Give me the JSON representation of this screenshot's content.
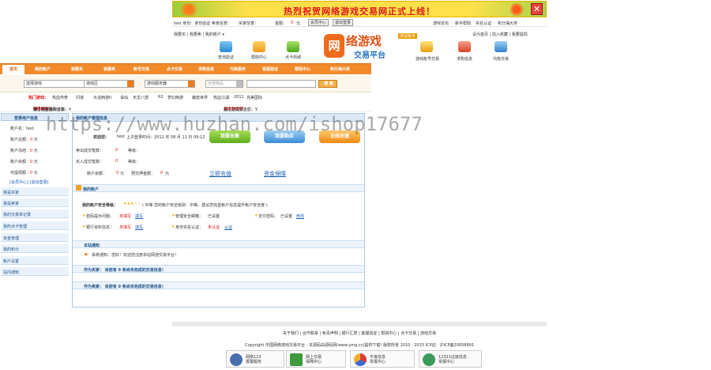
{
  "banner": {
    "text": "热烈祝贺网络游戏交易网正式上线！",
    "close": "✕"
  },
  "topbar": {
    "user": "test 身份：身份验证 卖家信誉：",
    "buyer": "买家信誉：",
    "balance": "金额：",
    "balance_value": "0",
    "unit": "元",
    "member_btn": "会员中心",
    "logout_btn": "退出登录",
    "links": [
      "游戏论坛",
      "新手帮助",
      "实名认证",
      "积分抽大奖"
    ]
  },
  "header": {
    "left_links": "我要买 | 我要卖 | 我的账户 ▾",
    "right_links": "设为首页 | 加入收藏 | 我要提现",
    "icons_left": [
      "查询验证",
      "帮助中心",
      "点卡商城"
    ],
    "logo_mark": "网",
    "logo_t1": "络游戏",
    "logo_t2": "交易平台",
    "logo_badge": "测试版本",
    "icons_right": [
      "游戏账号交易",
      "求购信息",
      "代练交易"
    ]
  },
  "nav": {
    "home": "首页",
    "items": [
      "我的帐户",
      "我要买",
      "我要卖",
      "帐号交易",
      "点卡交易",
      "求购信息",
      "代练服务",
      "客服验证",
      "帮助中心",
      "积分抽大奖"
    ]
  },
  "search": {
    "game": "选择游戏",
    "area": "游戏区",
    "server": "游戏服务器",
    "type": "全部物品",
    "keyword": "",
    "button": "搜 索"
  },
  "hot": {
    "label": "热门游戏：",
    "items": [
      "热血传奇",
      "问道",
      "大话西游II",
      "诛仙",
      "天龙八部",
      "R2",
      "梦幻西游",
      "魔兽世界",
      "热血江湖",
      "2011",
      "完美国际"
    ]
  },
  "stats": {
    "a_pre": "会员注册数：",
    "a_val": "643471",
    "a_mid": "个 | 玩家求购金额：¥",
    "a_amt": "4691235",
    "a_mid2": "元 | 寄售担保订单：",
    "a_cnt": "61763",
    "a_end": "单",
    "b_pre": "总成交次数：",
    "b_val": "385345",
    "b_mid": "单 | 总成交金额：¥",
    "b_amt": "16654387",
    "b_end": "元"
  },
  "sidebar": {
    "title": "登录用户信息",
    "user_label": "账户名：",
    "user_value": "test",
    "rows": [
      {
        "label": "账户总额：",
        "value": "0",
        "unit": "元"
      },
      {
        "label": "账户冻结：",
        "value": "0",
        "unit": "元"
      },
      {
        "label": "账户余额：",
        "value": "0",
        "unit": "元"
      },
      {
        "label": "可提现额：",
        "value": "0",
        "unit": "元"
      }
    ],
    "links": "[会员中心]    [退出登录]",
    "menu": [
      "我是买家",
      "我是卖家",
      "我的交易单记录",
      "我的点卡管理",
      "资金管理",
      "我的积分",
      "帐户设置",
      "站内通知"
    ]
  },
  "main": {
    "title": "我的帐户管理信息",
    "welcome": "欢迎您：",
    "username": "test",
    "last_login": "上次登录时间：2012 年 08 月 11 日 09:12",
    "btn_sell": "我要出售",
    "btn_buy": "我要购买",
    "btn_charge": "在线充值",
    "sold_label": "卖出成交笔数：",
    "sold_value": "0",
    "level_label": "等级：",
    "bought_label": "买入成交笔数：",
    "bought_value": "0",
    "account_label": "账户余额：",
    "account_value": "0",
    "account_unit": "元",
    "prepaid_label": "预交押金额：",
    "prepaid_value": "0",
    "prepaid_unit": "元",
    "link_recharge": "立即充值",
    "link_security": "资金保障",
    "section_account": "我的帐户",
    "safety_label": "我的帐户安全等级：",
    "safety_stars": "★★★☆☆",
    "safety_desc": "( 中等 您的帐户安全级别：中等。建议您完善帐户信息提升帐户安全度 )",
    "safety_level_word": "中等",
    "items": [
      {
        "label": "密码提示问题：",
        "status": "未填写",
        "action": "填写"
      },
      {
        "label": "管理安全邮箱：",
        "status": "已设置",
        "action": ""
      },
      {
        "label": "支付密码：",
        "status": "已设置",
        "action": "修改"
      },
      {
        "label": "银行资料信息：",
        "status": "未填写",
        "action": "填写"
      },
      {
        "label": "身份实名认证：",
        "status": "未认证",
        "action": "认证"
      }
    ],
    "notice_title": "本站通知",
    "notice_text": "系统通知：您好！欢迎您注册本站网游交易平台！",
    "buyer_note_pre": "作为买家：",
    "buyer_note": "目前有 0 条尚未完成的交易信息！",
    "seller_note_pre": "作为卖家：",
    "seller_note": "目前有 0 条尚未完成的交易信息！"
  },
  "watermark": "https://www.huzhan.com/ishop17677",
  "footer": {
    "links": "关于我们 | 合作联系 | 免责声明 | 银行汇款 | 客服验证 | 帮助中心 | 点卡交易 | 游戏交易",
    "copyright": "Copyright  中国网络游戏交易平台 - 本源码由源码网(www.ymg.cc)提供下载!   版权所有  2010 - 2015    ICP证：沪ICP备20058891",
    "badges": [
      {
        "line1": "网络110",
        "line2": "报警服务"
      },
      {
        "line1": "网上交易",
        "line2": "保障中心"
      },
      {
        "line1": "不良信息",
        "line2": "举报中心"
      },
      {
        "line1": "12321垃圾信息",
        "line2": "举报中心"
      }
    ]
  },
  "colors": {
    "orange": "#f08a2b",
    "blue": "#1a4f8a",
    "red": "#e01515"
  }
}
